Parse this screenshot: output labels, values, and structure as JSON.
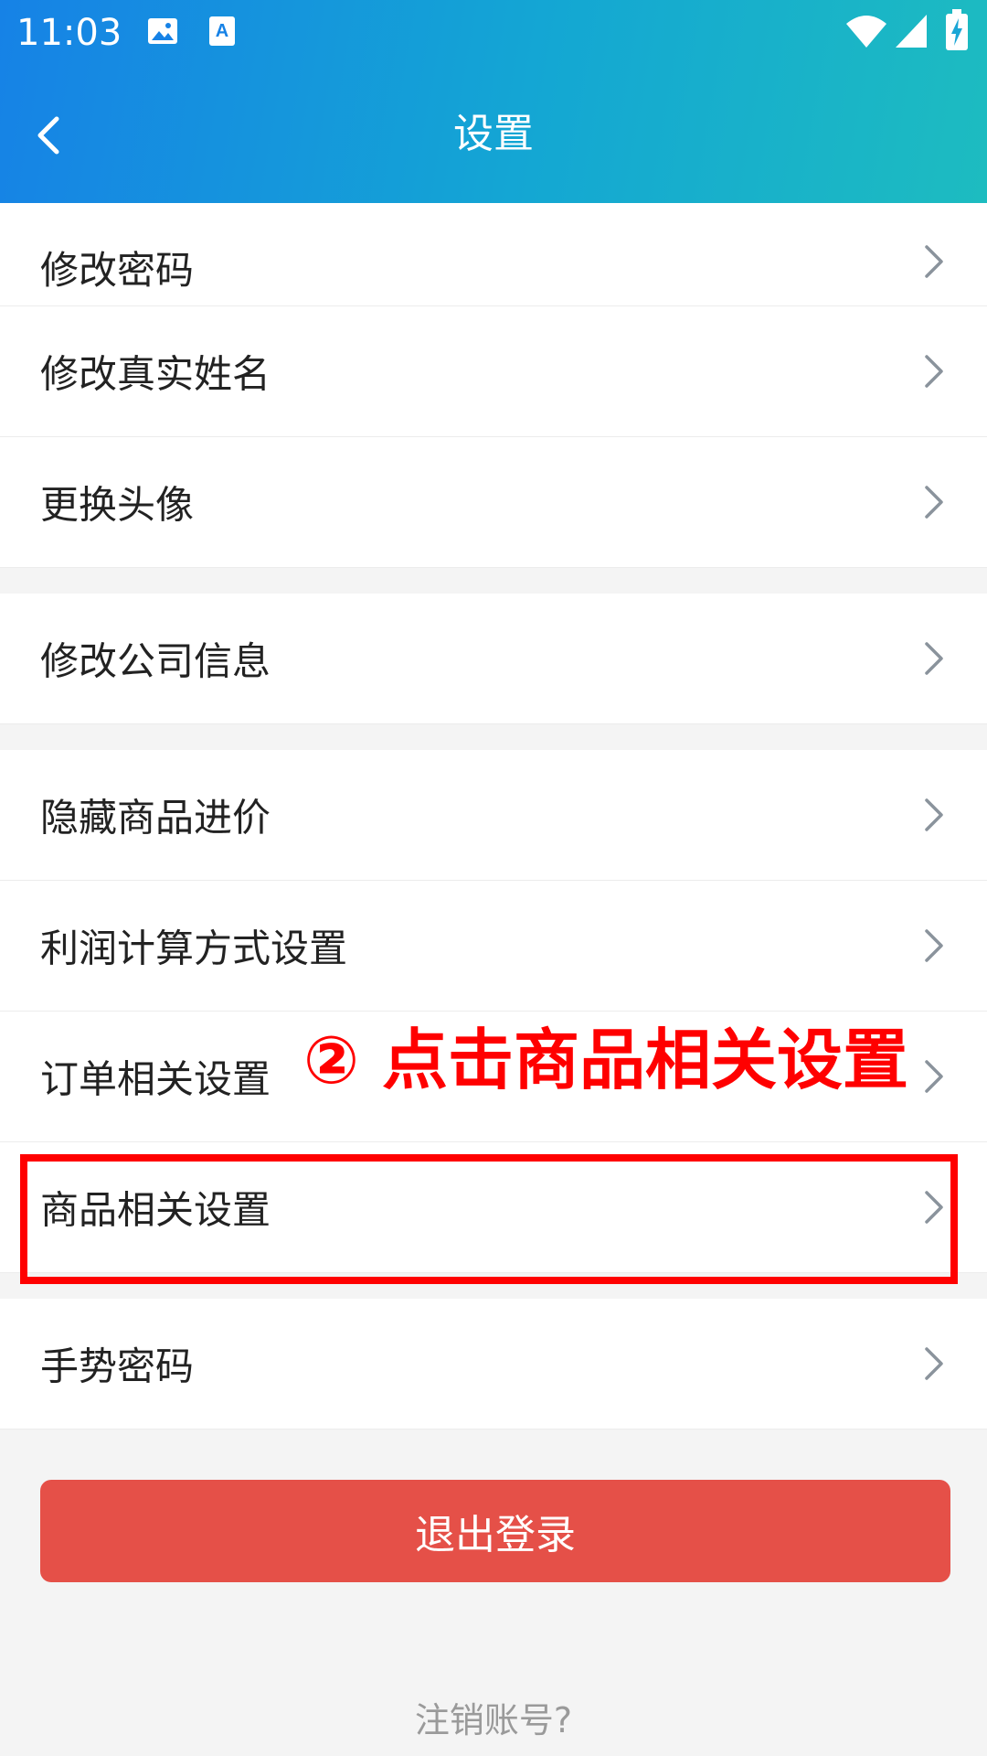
{
  "status_bar": {
    "time": "11:03",
    "icons": [
      "image-icon",
      "text-a-icon",
      "wifi-icon",
      "signal-icon",
      "battery-charging-icon"
    ]
  },
  "header": {
    "title": "设置",
    "back_icon": "chevron-left-icon"
  },
  "settings": {
    "groups": [
      {
        "items": [
          {
            "label": "修改密码"
          },
          {
            "label": "修改真实姓名"
          },
          {
            "label": "更换头像"
          }
        ]
      },
      {
        "items": [
          {
            "label": "修改公司信息"
          }
        ]
      },
      {
        "items": [
          {
            "label": "隐藏商品进价"
          },
          {
            "label": "利润计算方式设置"
          },
          {
            "label": "订单相关设置"
          },
          {
            "label": "商品相关设置"
          }
        ]
      },
      {
        "items": [
          {
            "label": "手势密码"
          }
        ]
      }
    ]
  },
  "annotation": {
    "text": "② 点击商品相关设置",
    "color": "#ff0000"
  },
  "actions": {
    "logout_label": "退出登录",
    "logout_color": "#e55048",
    "cancel_account_label": "注销账号?"
  },
  "colors": {
    "header_start": "#1682e6",
    "header_end": "#1dbcc0"
  }
}
